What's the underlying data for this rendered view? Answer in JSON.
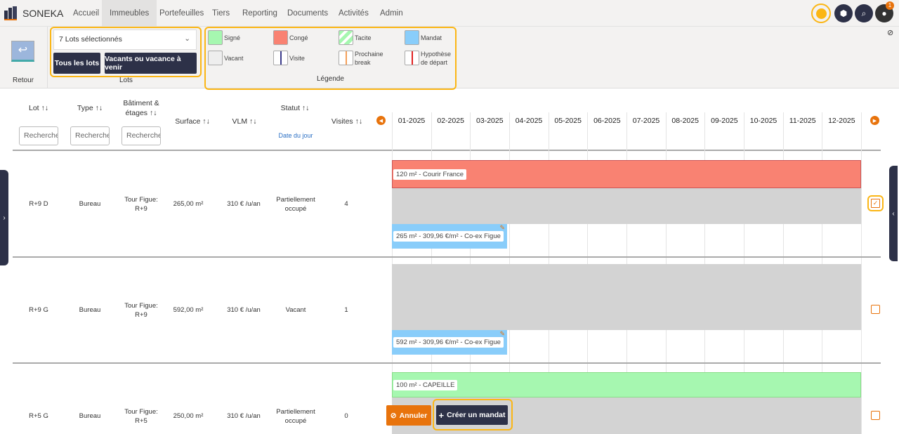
{
  "app": {
    "brand": "SONEKA"
  },
  "nav": [
    "Accueil",
    "Immeubles",
    "Portefeuilles",
    "Tiers",
    "Reporting",
    "Documents",
    "Activités",
    "Admin"
  ],
  "notifications": {
    "count": "1"
  },
  "ribbon": {
    "back_label": "Retour",
    "lots_select": "7 Lots sélectionnés",
    "all_lots": "Tous les lots",
    "vacants": "Vacants ou vacance à venir",
    "lots_group": "Lots",
    "legend_title": "Légende",
    "legend": [
      {
        "label": "Signé",
        "color": "#a6f7b0"
      },
      {
        "label": "Congé",
        "color": "#f98272"
      },
      {
        "label": "Tacite",
        "color": "#a6f7b0"
      },
      {
        "label": "Mandat",
        "color": "#89cdfa"
      },
      {
        "label": "Vacant",
        "color": "#eeeeee"
      },
      {
        "label": "Visite",
        "color": "#3b3b8a"
      },
      {
        "label": "Prochaine break",
        "color": "#f5a05a"
      },
      {
        "label": "Hypothèse de départ",
        "color": "#e02020"
      }
    ]
  },
  "table": {
    "headers": {
      "lot": "Lot ↑↓",
      "type": "Type ↑↓",
      "batiment": "Bâtiment & étages ↑↓",
      "surface": "Surface ↑↓",
      "vlm": "VLM ↑↓",
      "statut": "Statut ↑↓",
      "date_du_jour": "Date du jour",
      "visites": "Visites ↑↓"
    },
    "search_placeholder": "Recherche",
    "months": [
      "01-2025",
      "02-2025",
      "03-2025",
      "04-2025",
      "05-2025",
      "06-2025",
      "07-2025",
      "08-2025",
      "09-2025",
      "10-2025",
      "11-2025",
      "12-2025"
    ],
    "rows": [
      {
        "lot": "R+9 D",
        "type": "Bureau",
        "batiment": "Tour Figue: R+9",
        "surface": "265,00 m²",
        "vlm": "310 € /u/an",
        "statut": "Partiellement occupé",
        "visites": "4",
        "bar1": "120 m² - Courir France",
        "bar2": "265 m² - 309,96 €/m² - Co-ex Figue",
        "checked": true
      },
      {
        "lot": "R+9 G",
        "type": "Bureau",
        "batiment": "Tour Figue: R+9",
        "surface": "592,00 m²",
        "vlm": "310 € /u/an",
        "statut": "Vacant",
        "visites": "1",
        "bar2": "592 m² - 309,96 €/m² - Co-ex Figue",
        "checked": false
      },
      {
        "lot": "R+5 G",
        "type": "Bureau",
        "batiment": "Tour Figue: R+5",
        "surface": "250,00 m²",
        "vlm": "310 € /u/an",
        "statut": "Partiellement occupé",
        "visites": "0",
        "bar1": "100 m² - CAPEILLE",
        "checked": false
      }
    ]
  },
  "actions": {
    "cancel": "Annuler",
    "create_mandate": "Créer un mandat"
  }
}
